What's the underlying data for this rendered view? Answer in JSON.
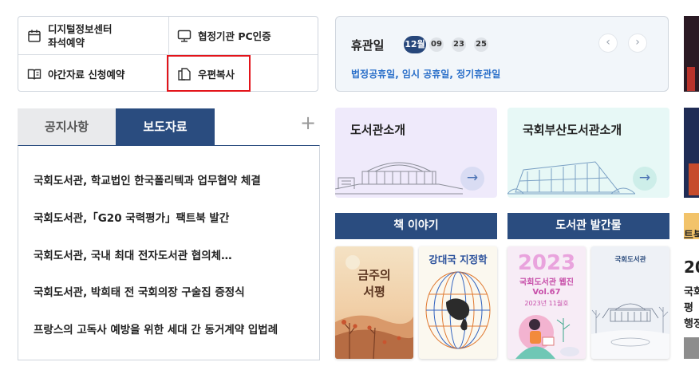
{
  "quick_menu": {
    "items": [
      {
        "label_line1": "디지털정보센터",
        "label_line2": "좌석예약",
        "icon": "calendar-icon"
      },
      {
        "label": "협정기관 PC인증",
        "icon": "monitor-icon"
      },
      {
        "label": "야간자료 신청예약",
        "icon": "book-open-icon"
      },
      {
        "label": "우편복사",
        "icon": "copy-document-icon"
      }
    ]
  },
  "holiday": {
    "title": "휴관일",
    "month": "12월",
    "days": [
      "09",
      "23",
      "25"
    ],
    "subtitle": "법정공휴일, 임시 공휴일, 정기휴관일",
    "prev_label": "‹",
    "next_label": "›"
  },
  "notice": {
    "tabs": [
      {
        "label": "공지사항",
        "active": false
      },
      {
        "label": "보도자료",
        "active": true
      }
    ],
    "more_label": "+",
    "items": [
      "국회도서관, 학교법인 한국폴리텍과 업무협약 체결",
      "국회도서관,「G20 국력평가」팩트북 발간",
      "국회도서관, 국내 최대 전자도서관 협의체…",
      "국회도서관, 박희태 전 국회의장 구술집 증정식",
      "프랑스의 고독사 예방을 위한 세대 간 동거계약 입법례"
    ]
  },
  "intro_cards": [
    {
      "title": "도서관소개",
      "arrow": "→"
    },
    {
      "title": "국회부산도서관소개",
      "arrow": "→"
    }
  ],
  "sections": {
    "story": {
      "heading": "책 이야기",
      "books": [
        {
          "title_line1": "금주의",
          "title_line2": "서평"
        },
        {
          "title": "강대국 지정학"
        }
      ]
    },
    "publications": {
      "heading": "도서관 발간물",
      "books": [
        {
          "year": "2023",
          "title": "국회도서관 웹진",
          "vol": "Vol.67",
          "issue": "2023년 11월호"
        },
        {
          "title": "국회도서관"
        }
      ]
    }
  },
  "right_edge": {
    "partial_lines": [
      "트북",
      "20",
      "국회",
      "평",
      "행정"
    ]
  },
  "colors": {
    "navy": "#2a4c7f",
    "link_blue": "#2a6fc9",
    "highlight_red": "#e3141a"
  }
}
